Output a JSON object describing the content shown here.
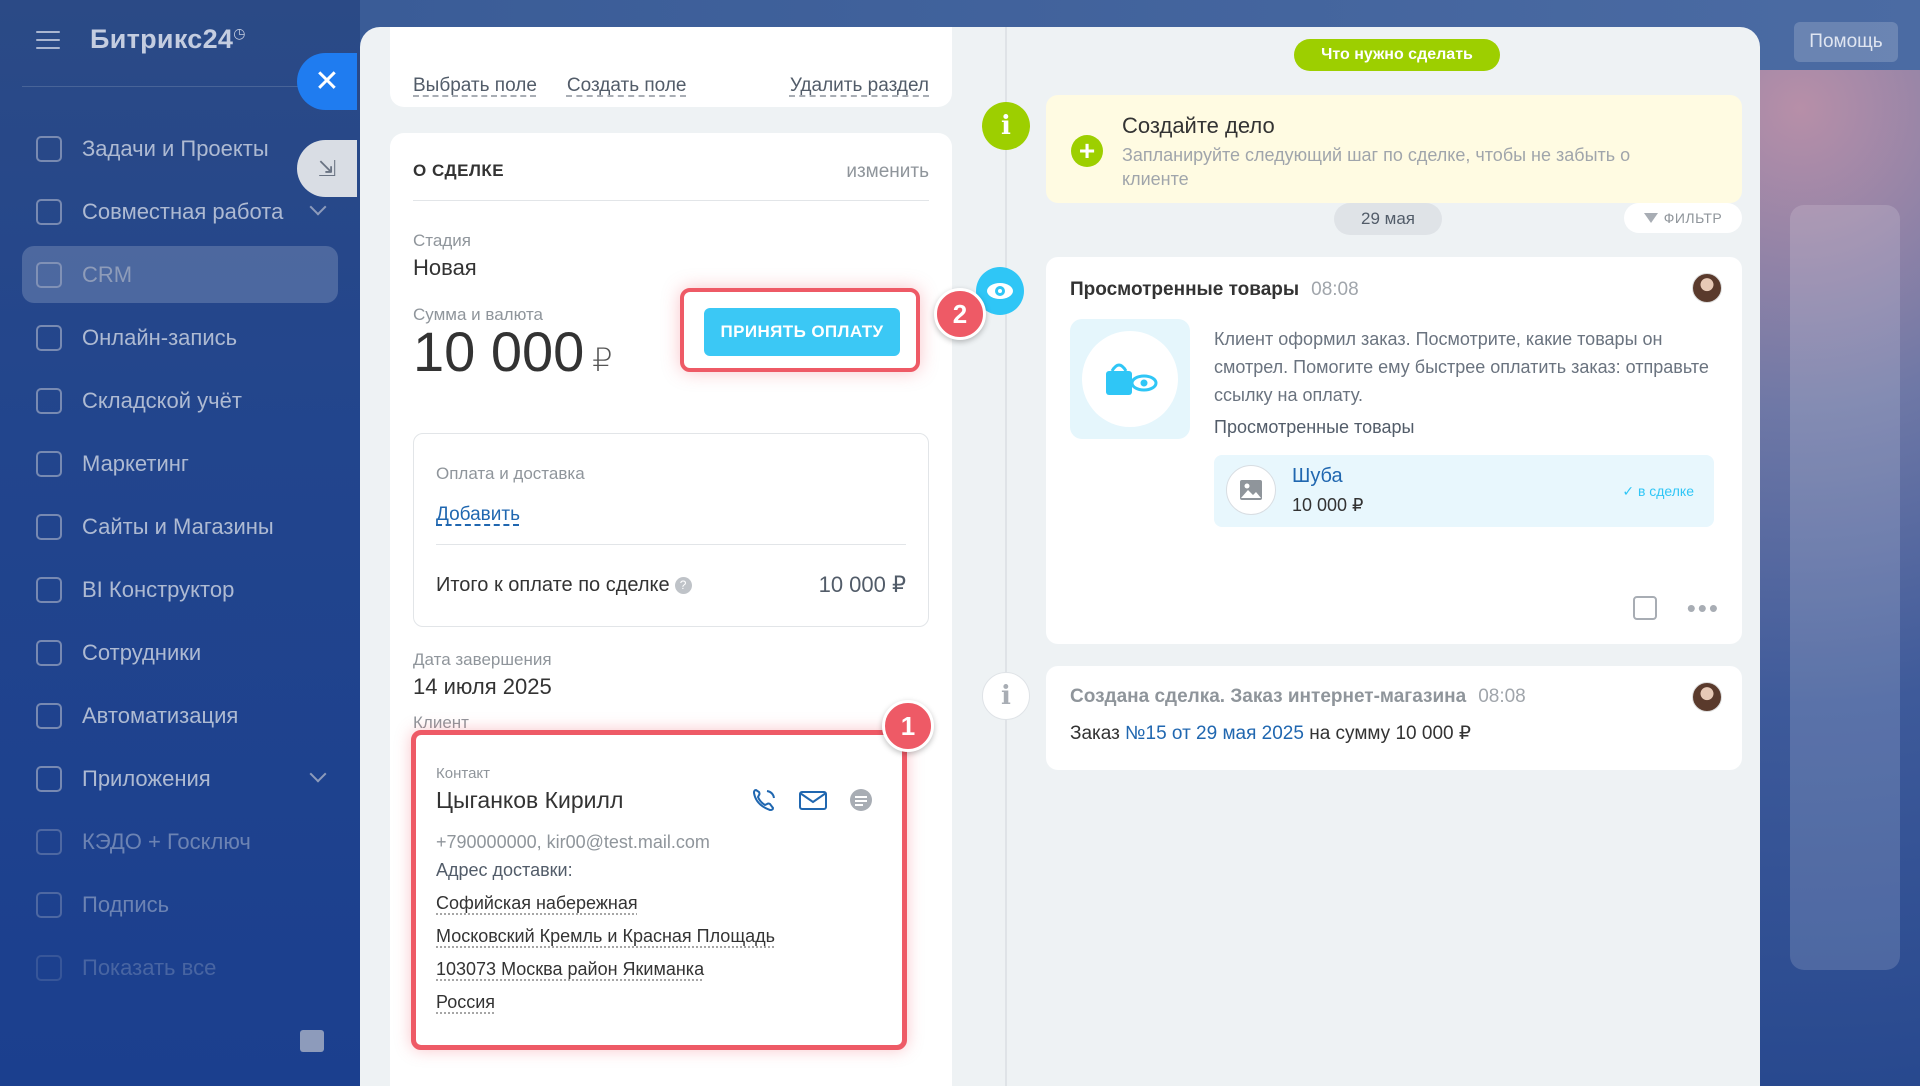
{
  "app": {
    "logo": "Битрикс24",
    "logo_mark": "◷",
    "help": "Помощь"
  },
  "sidebar": {
    "items": [
      {
        "label": "Задачи и Проекты",
        "icon": "checkbox-icon"
      },
      {
        "label": "Совместная работа",
        "icon": "collab-icon",
        "chevron": true
      },
      {
        "label": "CRM",
        "icon": "crm-icon",
        "active": true
      },
      {
        "label": "Онлайн-запись",
        "icon": "calendar-icon"
      },
      {
        "label": "Складской учёт",
        "icon": "warehouse-icon"
      },
      {
        "label": "Маркетинг",
        "icon": "marketing-icon"
      },
      {
        "label": "Сайты и Магазины",
        "icon": "cart-icon"
      },
      {
        "label": "BI Конструктор",
        "icon": "chart-icon"
      },
      {
        "label": "Сотрудники",
        "icon": "employees-icon"
      },
      {
        "label": "Автоматизация",
        "icon": "robot-icon"
      },
      {
        "label": "Приложения",
        "icon": "apps-icon",
        "chevron": true
      },
      {
        "label": "КЭДО + Госключ",
        "icon": "docs-icon"
      },
      {
        "label": "Подпись",
        "icon": "sign-icon"
      },
      {
        "label": "Показать все",
        "icon": "chevron-icon"
      }
    ]
  },
  "deal": {
    "links": {
      "select_field": "Выбрать поле",
      "create_field": "Создать поле",
      "delete_section": "Удалить раздел"
    },
    "section_title": "О СДЕЛКЕ",
    "edit": "изменить",
    "stage_label": "Стадия",
    "stage_value": "Новая",
    "sum_label": "Сумма и валюта",
    "sum_value": "10 000",
    "currency": "₽",
    "pay_button": "ПРИНЯТЬ ОПЛАТУ",
    "payment_label": "Оплата и доставка",
    "payment_add": "Добавить",
    "total_label": "Итого к оплате по сделке",
    "total_value": "10 000 ₽",
    "close_date_label": "Дата завершения",
    "close_date_value": "14 июля 2025",
    "client_label": "Клиент",
    "contact_label": "Контакт",
    "contact_name": "Цыганков Кирилл",
    "contact_info": "+790000000, kir00@test.mail.com",
    "address_label": "Адрес доставки:",
    "address_lines": [
      "Софийская набережная",
      "Московский Кремль и Красная Площадь",
      "103073 Москва район Якиманка",
      "Россия"
    ],
    "badge_1": "1",
    "badge_2": "2"
  },
  "timeline": {
    "todo_pill": "Что нужно сделать",
    "todo_title": "Создайте дело",
    "todo_sub": "Запланируйте следующий шаг по сделке, чтобы не забыть о клиенте",
    "date": "29 мая",
    "filter": "ФИЛЬТР",
    "viewed": {
      "title": "Просмотренные товары",
      "time": "08:08",
      "text": "Клиент оформил заказ. Посмотрите, какие товары он смотрел. Помогите ему быстрее оплатить заказ: отправьте ссылку на оплату.",
      "subtitle": "Просмотренные товары",
      "product_name": "Шуба",
      "product_price": "10 000 ₽",
      "product_status": "в сделке"
    },
    "created": {
      "title": "Создана сделка. Заказ интернет-магазина",
      "time": "08:08",
      "prefix": "Заказ",
      "link": "№15 от 29 мая 2025",
      "suffix": "на сумму 10 000 ₽"
    }
  },
  "colors": {
    "accent": "#3bc8f5",
    "highlight": "#ee5a66",
    "todo": "#9dcf00",
    "link": "#2067b0"
  }
}
